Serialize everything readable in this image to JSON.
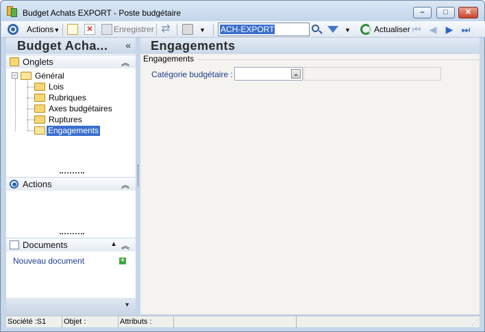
{
  "window": {
    "app_title": "Budget Achats EXPORT -",
    "doc_title": "Poste budgétaire"
  },
  "toolbar": {
    "actions_label": "Actions",
    "save_label": "Enregistrer",
    "search_value": "ACH-EXPORT",
    "refresh_label": "Actualiser"
  },
  "sidebar": {
    "title": "Budget Acha...",
    "onglets_title": "Onglets",
    "tree": {
      "root": "Général",
      "children": [
        "Lois",
        "Rubriques",
        "Axes budgétaires",
        "Ruptures",
        "Engagements"
      ]
    },
    "actions_title": "Actions",
    "documents_title": "Documents",
    "new_document": "Nouveau document"
  },
  "main": {
    "title": "Engagements",
    "group_title": "Engagements",
    "field_label": "Catégorie budgétaire :",
    "field_value": "",
    "field_description": ""
  },
  "statusbar": {
    "societe": "Société :S1",
    "objet": "Objet :",
    "attributs": "Attributs :"
  },
  "colors": {
    "accent": "#3a6fcf",
    "frame": "#c7d6e8",
    "label_blue": "#1d3c8e"
  }
}
